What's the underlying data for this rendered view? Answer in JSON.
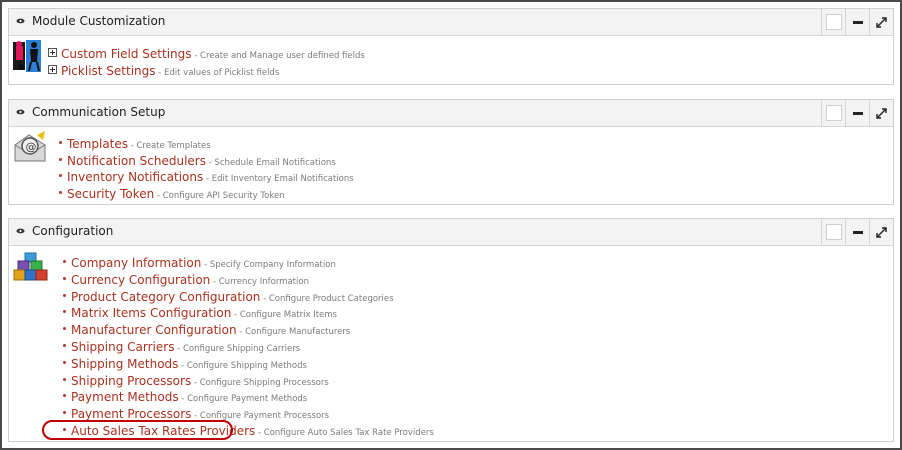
{
  "panels": [
    {
      "title": "Module Customization",
      "icon": "people-icon",
      "items": [
        {
          "label": "Custom Field Settings",
          "desc": "Create and Manage user defined fields",
          "marker": "plus"
        },
        {
          "label": "Picklist Settings",
          "desc": "Edit values of Picklist fields",
          "marker": "plus"
        }
      ]
    },
    {
      "title": "Communication Setup",
      "icon": "email-icon",
      "items": [
        {
          "label": "Templates",
          "desc": "Create Templates",
          "marker": "bullet"
        },
        {
          "label": "Notification Schedulers",
          "desc": "Schedule Email Notifications",
          "marker": "bullet"
        },
        {
          "label": "Inventory Notifications",
          "desc": "Edit Inventory Email Notifications",
          "marker": "bullet"
        },
        {
          "label": "Security Token",
          "desc": "Configure API Security Token",
          "marker": "bullet"
        }
      ]
    },
    {
      "title": "Configuration",
      "icon": "boxes-icon",
      "items": [
        {
          "label": "Company Information",
          "desc": "Specify Company Information",
          "marker": "bullet"
        },
        {
          "label": "Currency Configuration",
          "desc": "Currency Information",
          "marker": "bullet"
        },
        {
          "label": "Product Category Configuration",
          "desc": "Configure Product Categories",
          "marker": "bullet"
        },
        {
          "label": "Matrix Items Configuration",
          "desc": "Configure Matrix Items",
          "marker": "bullet"
        },
        {
          "label": "Manufacturer Configuration",
          "desc": "Configure Manufacturers",
          "marker": "bullet"
        },
        {
          "label": "Shipping Carriers",
          "desc": "Configure Shipping Carriers",
          "marker": "bullet"
        },
        {
          "label": "Shipping Methods",
          "desc": "Configure Shipping Methods",
          "marker": "bullet"
        },
        {
          "label": "Shipping Processors",
          "desc": "Configure Shipping Processors",
          "marker": "bullet"
        },
        {
          "label": "Payment Methods",
          "desc": "Configure Payment Methods",
          "marker": "bullet"
        },
        {
          "label": "Payment Processors",
          "desc": "Configure Payment Processors",
          "marker": "bullet"
        },
        {
          "label": "Auto Sales Tax Rates Providers",
          "desc": "Configure Auto Sales Tax Rate Providers",
          "marker": "bullet",
          "highlighted": true
        }
      ]
    }
  ],
  "colors": {
    "link": "#a8321f",
    "highlight": "#c00000",
    "header_bg": "#f3f3f3"
  }
}
